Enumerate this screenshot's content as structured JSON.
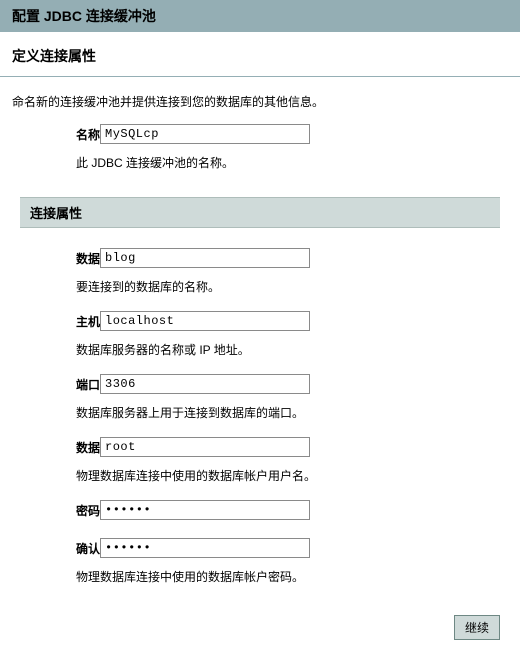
{
  "page": {
    "title": "配置  JDBC 连接缓冲池",
    "section_title": "定义连接属性",
    "description": "命名新的连接缓冲池并提供连接到您的数据库的其他信息。"
  },
  "basic": {
    "name_label": "名称:",
    "name_value": "MySQLcp",
    "name_help": "此 JDBC 连接缓冲池的名称。"
  },
  "props_header": "连接属性",
  "props": {
    "db_label": "数据库名称:",
    "db_value": "blog",
    "db_help": "要连接到的数据库的名称。",
    "host_label": "主机名:",
    "host_value": "localhost",
    "host_help": "数据库服务器的名称或 IP 地址。",
    "port_label": "端口:",
    "port_value": "3306",
    "port_help": "数据库服务器上用于连接到数据库的端口。",
    "user_label": "数据库用户名:",
    "user_value": "root",
    "user_help": "物理数据库连接中使用的数据库帐户用户名。",
    "pw_label": "密码:",
    "pw_value": "aaaaaa",
    "cpw_label": "确认密码:",
    "cpw_value": "aaaaaa",
    "pw_help": "物理数据库连接中使用的数据库帐户密码。"
  },
  "buttons": {
    "continue": "继续"
  }
}
